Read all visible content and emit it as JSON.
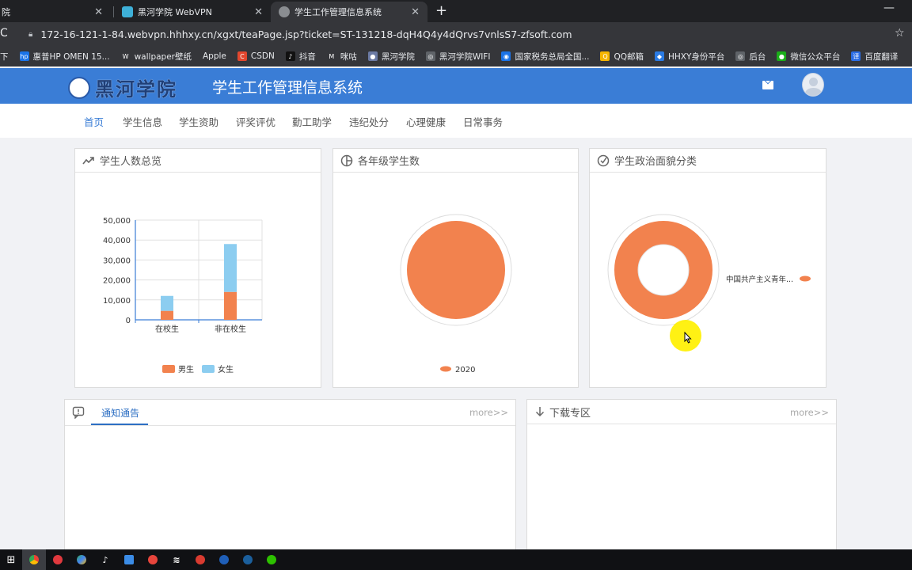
{
  "browser": {
    "tabs": [
      {
        "title": "院",
        "close": "✕"
      },
      {
        "title": "黑河学院 WebVPN",
        "close": "✕"
      },
      {
        "title": "学生工作管理信息系统",
        "close": "✕"
      }
    ],
    "new_tab": "+",
    "minimize": "—",
    "reload": "C",
    "url": "172-16-121-1-84.webvpn.hhhxy.cn/xgxt/teaPage.jsp?ticket=ST-131218-dqH4Q4y4dQrvs7vnlsS7-zfsoft.com",
    "bookmarks": [
      {
        "label": "下",
        "icon_color": "#35363a",
        "icon": ""
      },
      {
        "label": "惠普HP OMEN 15...",
        "icon_color": "#1a73e8",
        "icon": "hp"
      },
      {
        "label": "wallpaper壁纸",
        "icon_color": "#35363a",
        "icon": "W"
      },
      {
        "label": "Apple",
        "icon_color": "#35363a",
        "icon": ""
      },
      {
        "label": "CSDN",
        "icon_color": "#e3472e",
        "icon": "C"
      },
      {
        "label": "抖音",
        "icon_color": "#111111",
        "icon": "♪"
      },
      {
        "label": "咪咕",
        "icon_color": "#35363a",
        "icon": "M"
      },
      {
        "label": "黑河学院",
        "icon_color": "#6b7aa3",
        "icon": "●"
      },
      {
        "label": "黑河学院WIFI",
        "icon_color": "#5f6368",
        "icon": "◎"
      },
      {
        "label": "国家税务总局全国...",
        "icon_color": "#1a73e8",
        "icon": "◉"
      },
      {
        "label": "QQ邮箱",
        "icon_color": "#f4b400",
        "icon": "Q"
      },
      {
        "label": "HHXY身份平台",
        "icon_color": "#2a7be4",
        "icon": "◆"
      },
      {
        "label": "后台",
        "icon_color": "#5f6368",
        "icon": "◎"
      },
      {
        "label": "微信公众平台",
        "icon_color": "#1aad19",
        "icon": "●"
      },
      {
        "label": "百度翻译",
        "icon_color": "#2b6de5",
        "icon": "译"
      }
    ]
  },
  "app": {
    "logo_text": "黑河学院",
    "title": "学生工作管理信息系统",
    "nav": [
      "首页",
      "学生信息",
      "学生资助",
      "评奖评优",
      "勤工助学",
      "违纪处分",
      "心理健康",
      "日常事务"
    ],
    "active_nav": 0
  },
  "cards": {
    "students_overview": {
      "title": "学生人数总览"
    },
    "grade_students": {
      "title": "各年级学生数"
    },
    "political_status": {
      "title": "学生政治面貌分类"
    }
  },
  "panels": {
    "notices": {
      "tab": "通知通告",
      "more": "more>>"
    },
    "downloads": {
      "title": "下载专区",
      "more": "more>>"
    }
  },
  "colors": {
    "orange": "#f2824e",
    "blue": "#8ccdf0",
    "header": "#3a7dd6"
  },
  "chart_data": [
    {
      "type": "bar",
      "stacked": true,
      "categories": [
        "在校生",
        "非在校生"
      ],
      "series": [
        {
          "name": "男生",
          "values": [
            4500,
            14000
          ],
          "color": "#f2824e"
        },
        {
          "name": "女生",
          "values": [
            7500,
            24000
          ],
          "color": "#8ccdf0"
        }
      ],
      "ylim": [
        0,
        50000
      ],
      "yticks": [
        "50,000",
        "40,000",
        "30,000",
        "20,000",
        "10,000",
        "0"
      ],
      "legend": "bottom"
    },
    {
      "type": "pie",
      "labels": [
        "2020"
      ],
      "values": [
        1
      ],
      "legend": "bottom"
    },
    {
      "type": "pie",
      "donut": true,
      "labels": [
        "中国共产主义青年..."
      ],
      "values": [
        1
      ],
      "legend": "right"
    }
  ]
}
